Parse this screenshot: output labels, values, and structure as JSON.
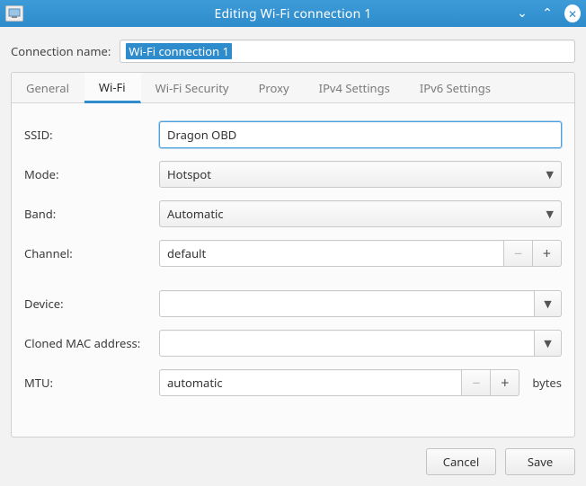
{
  "window": {
    "title": "Editing Wi-Fi connection 1"
  },
  "connection_name": {
    "label": "Connection name:",
    "value": "Wi-Fi connection 1"
  },
  "tabs": [
    {
      "label": "General"
    },
    {
      "label": "Wi-Fi"
    },
    {
      "label": "Wi-Fi Security"
    },
    {
      "label": "Proxy"
    },
    {
      "label": "IPv4 Settings"
    },
    {
      "label": "IPv6 Settings"
    }
  ],
  "active_tab_index": 1,
  "wifi": {
    "ssid": {
      "label": "SSID:",
      "value": "Dragon OBD"
    },
    "mode": {
      "label": "Mode:",
      "value": "Hotspot"
    },
    "band": {
      "label": "Band:",
      "value": "Automatic"
    },
    "channel": {
      "label": "Channel:",
      "value": "default"
    },
    "device": {
      "label": "Device:",
      "value": ""
    },
    "cloned_mac": {
      "label": "Cloned MAC address:",
      "value": ""
    },
    "mtu": {
      "label": "MTU:",
      "value": "automatic",
      "suffix": "bytes"
    }
  },
  "footer": {
    "cancel": "Cancel",
    "save": "Save"
  }
}
